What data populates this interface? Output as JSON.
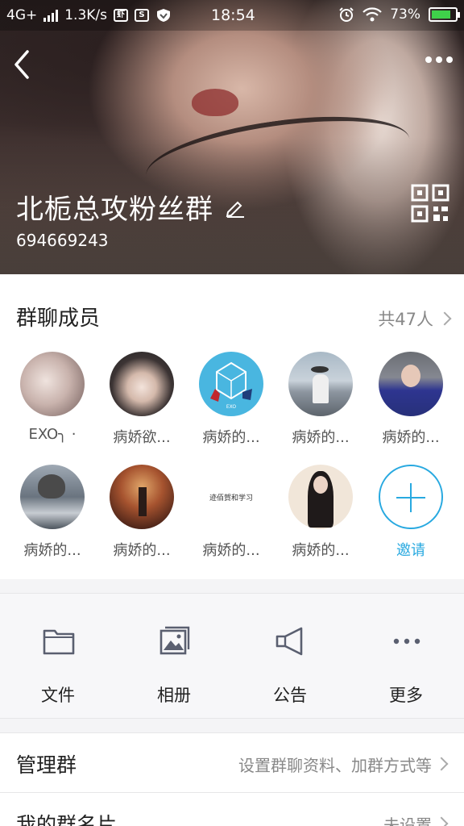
{
  "status_bar": {
    "network": "4G+",
    "speed": "1.3K/s",
    "app_badge_1": "虾",
    "app_badge_2": "S",
    "time": "18:54",
    "battery": "73%"
  },
  "header": {
    "group_name": "北栀总攻粉丝群",
    "group_id": "694669243"
  },
  "members": {
    "title": "群聊成员",
    "count_label": "共47人",
    "items": [
      {
        "name": "EXO╮ ·",
        "avatar_color": "#d9c8c4"
      },
      {
        "name": "病娇欲...",
        "avatar_color": "#4a4648"
      },
      {
        "name": "病娇的...",
        "avatar_color": "#49b6e0"
      },
      {
        "name": "病娇的...",
        "avatar_color": "#b9c3cc"
      },
      {
        "name": "病娇的...",
        "avatar_color": "#3a3f8c"
      },
      {
        "name": "病娇的...",
        "avatar_color": "#7a8591"
      },
      {
        "name": "病娇的...",
        "avatar_color": "#8a3a2a"
      },
      {
        "name": "病娇的...",
        "avatar_color": "#ffffff"
      },
      {
        "name": "病娇的...",
        "avatar_color": "#f1e6d9"
      }
    ],
    "avatar_3_text": "EXO",
    "avatar_8_text": "迹佰賀和学习",
    "invite_label": "邀请"
  },
  "tools": [
    {
      "label": "文件",
      "icon": "folder-icon"
    },
    {
      "label": "相册",
      "icon": "album-icon"
    },
    {
      "label": "公告",
      "icon": "megaphone-icon"
    },
    {
      "label": "更多",
      "icon": "more-icon"
    }
  ],
  "rows": {
    "manage": {
      "title": "管理群",
      "value": "设置群聊资料、加群方式等"
    },
    "card": {
      "title": "我的群名片",
      "value": "未设置"
    }
  }
}
